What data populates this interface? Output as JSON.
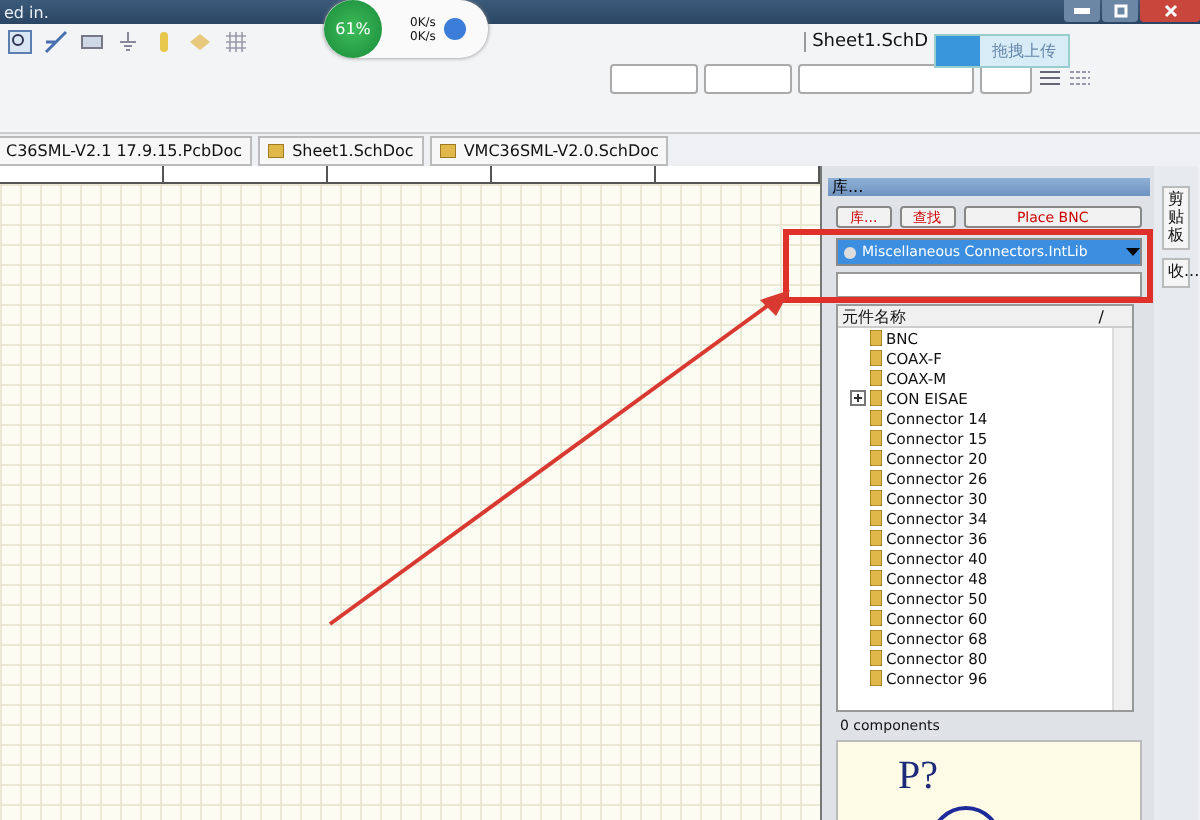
{
  "window": {
    "title": "ed in."
  },
  "network_widget": {
    "percent": "61%",
    "upload": "0K/s",
    "download": "0K/s"
  },
  "toolbar_tab": "Sheet1.SchD",
  "upload_tooltip": "拖拽上传",
  "document_tabs": [
    "C36SML-V2.1 17.9.15.PcbDoc",
    "Sheet1.SchDoc",
    "VMC36SML-V2.0.SchDoc"
  ],
  "library_panel": {
    "title": "库...",
    "buttons": [
      "库...",
      "查找",
      "Place BNC"
    ],
    "library": "Miscellaneous Connectors.IntLib",
    "column": "元件名称",
    "sort_mark": "/",
    "items": [
      {
        "label": "BNC",
        "kind": "part"
      },
      {
        "label": "COAX-F",
        "kind": "part"
      },
      {
        "label": "COAX-M",
        "kind": "part"
      },
      {
        "label": "CON EISAE",
        "kind": "group"
      },
      {
        "label": "Connector 14",
        "kind": "part"
      },
      {
        "label": "Connector 15",
        "kind": "part"
      },
      {
        "label": "Connector 20",
        "kind": "part"
      },
      {
        "label": "Connector 26",
        "kind": "part"
      },
      {
        "label": "Connector 30",
        "kind": "part"
      },
      {
        "label": "Connector 34",
        "kind": "part"
      },
      {
        "label": "Connector 36",
        "kind": "part"
      },
      {
        "label": "Connector 40",
        "kind": "part"
      },
      {
        "label": "Connector 48",
        "kind": "part"
      },
      {
        "label": "Connector 50",
        "kind": "part"
      },
      {
        "label": "Connector 60",
        "kind": "part"
      },
      {
        "label": "Connector 68",
        "kind": "part"
      },
      {
        "label": "Connector 80",
        "kind": "part"
      },
      {
        "label": "Connector 96",
        "kind": "part"
      }
    ],
    "status": "0 components",
    "preview_designator": "P?"
  },
  "side_tabs": [
    "剪贴板",
    "收..."
  ]
}
